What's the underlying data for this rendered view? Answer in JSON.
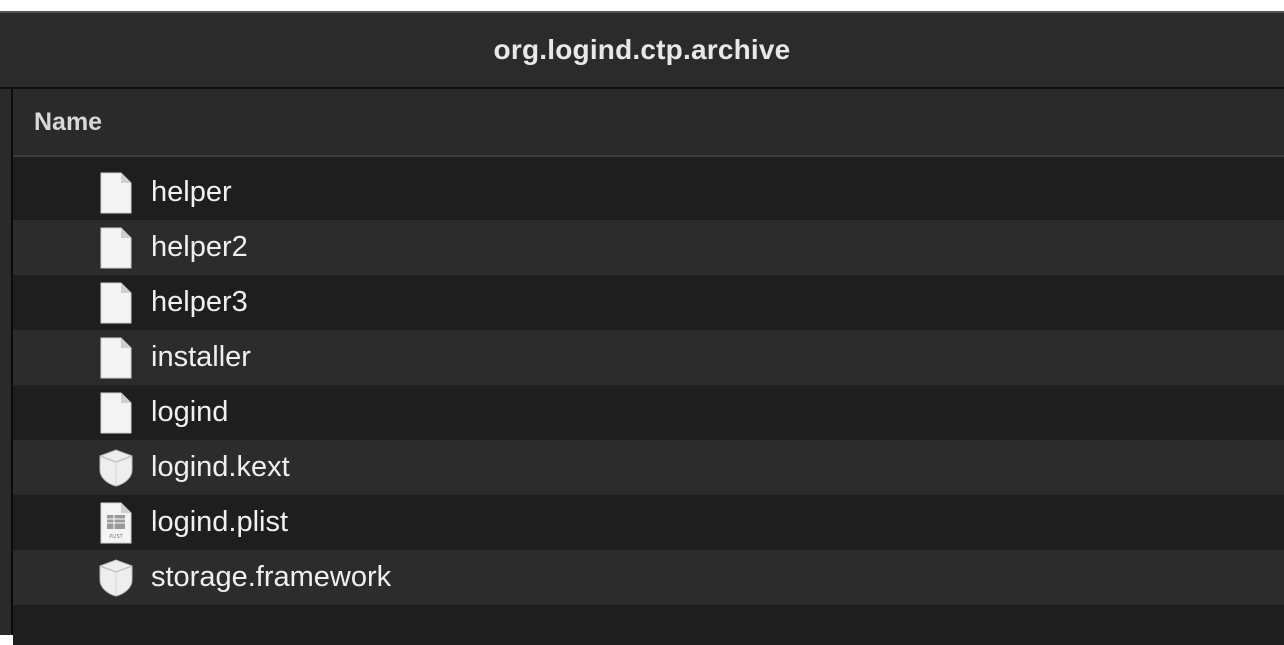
{
  "window": {
    "title": "org.logind.ctp.archive"
  },
  "list": {
    "column_header": "Name",
    "items": [
      {
        "name": "helper",
        "icon": "document-icon"
      },
      {
        "name": "helper2",
        "icon": "document-icon"
      },
      {
        "name": "helper3",
        "icon": "document-icon"
      },
      {
        "name": "installer",
        "icon": "document-icon"
      },
      {
        "name": "logind",
        "icon": "document-icon"
      },
      {
        "name": "logind.kext",
        "icon": "bundle-icon"
      },
      {
        "name": "logind.plist",
        "icon": "plist-icon"
      },
      {
        "name": "storage.framework",
        "icon": "bundle-icon"
      }
    ],
    "plist_icon_caption": "PLIST"
  },
  "colors": {
    "window_bg": "#1e1e1e",
    "titlebar_bg": "#2b2b2b",
    "row_alt_bg": "#2c2c2c",
    "text": "#f0f0f0"
  }
}
